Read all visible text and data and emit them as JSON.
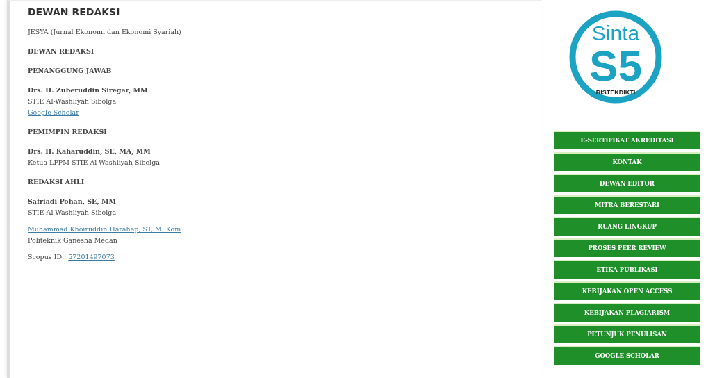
{
  "page_title": "DEWAN REDAKSI",
  "content": [
    {
      "kind": "text",
      "text": "JESYA (Jurnal Ekonomi dan Ekonomi Syariah)"
    },
    {
      "kind": "heading",
      "text": "DEWAN REDAKSI"
    },
    {
      "kind": "heading",
      "text": "PENANGGUNG JAWAB"
    },
    {
      "kind": "name",
      "text": "Drs. H. Zuberuddin Siregar, MM"
    },
    {
      "kind": "text",
      "text": "STIE Al-Washliyah Sibolga"
    },
    {
      "kind": "link",
      "text": "Google Scholar"
    },
    {
      "kind": "heading",
      "text": "PEMIMPIN REDAKSI"
    },
    {
      "kind": "name",
      "text": "Drs. H. Kaharuddin, SE, MA, MM"
    },
    {
      "kind": "text",
      "text": "Ketua LPPM STIE Al-Washliyah Sibolga"
    },
    {
      "kind": "heading",
      "text": "REDAKSI AHLI"
    },
    {
      "kind": "name",
      "text": "Safriadi Pohan, SE, MM"
    },
    {
      "kind": "text",
      "text": "STIE Al-Washliyah Sibolga"
    },
    {
      "kind": "link",
      "text": "Muhammad Khoiruddin Harahap, ST, M. Kom"
    },
    {
      "kind": "text",
      "text": "Politeknik Ganesha Medan"
    },
    {
      "kind": "labeled_link",
      "label": "Scopus ID : ",
      "text": "57201497073"
    }
  ],
  "logo": {
    "title": "Sinta",
    "grade": "S5",
    "subtitle": "RISTEKDIKTI"
  },
  "menu": [
    "E-SERTIFIKAT AKREDITASI",
    "KONTAK",
    "DEWAN EDITOR",
    "MITRA BERESTARI",
    "RUANG LINGKUP",
    "PROSES PEER REVIEW",
    "ETIKA PUBLIKASI",
    "KEBIJAKAN OPEN ACCESS",
    "KEBIJAKAN PLAGIARISM",
    "PETUNJUK PENULISAN",
    "GOOGLE SCHOLAR"
  ]
}
